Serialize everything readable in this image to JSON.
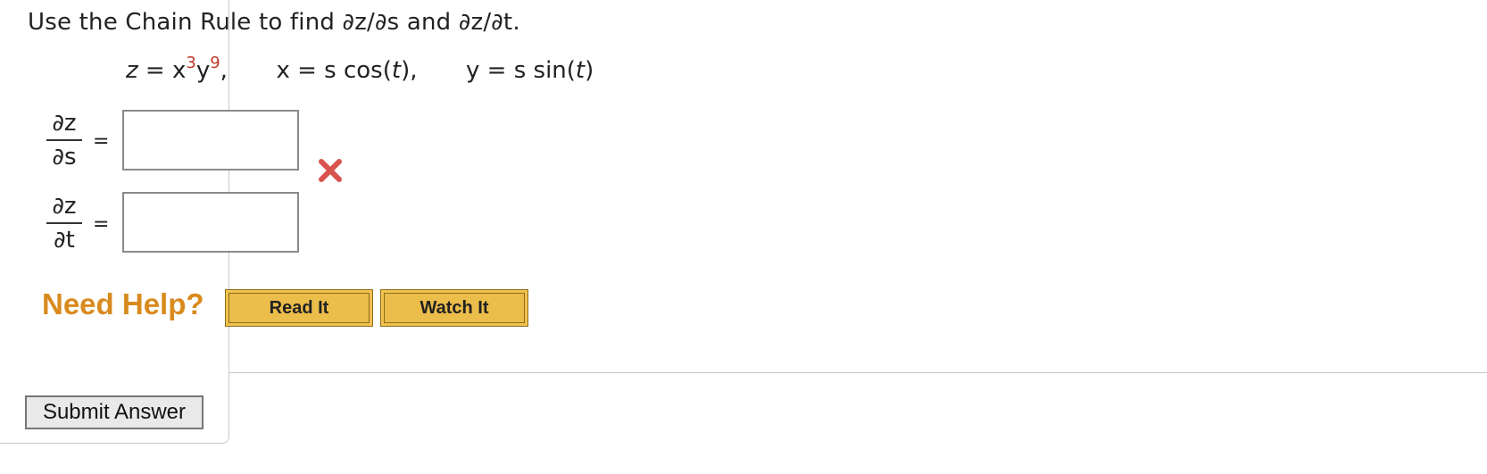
{
  "question": {
    "prompt": "Use the Chain Rule to find ∂z/∂s and ∂z/∂t.",
    "formula": {
      "z_lhs": "z",
      "z_eq": " = x",
      "z_exp1": "3",
      "z_mid": "y",
      "z_exp2": "9",
      "z_comma": ",",
      "x_part": "x = s cos(",
      "x_t": "t",
      "x_close": "),",
      "y_part": "y = s sin(",
      "y_t": "t",
      "y_close": ")"
    }
  },
  "answers": [
    {
      "num": "∂z",
      "den": "∂s",
      "eq": "=",
      "value": "",
      "status": "incorrect"
    },
    {
      "num": "∂z",
      "den": "∂t",
      "eq": "=",
      "value": "",
      "status": ""
    }
  ],
  "help": {
    "label": "Need Help?",
    "read_it": "Read It",
    "watch_it": "Watch It"
  },
  "submit_label": "Submit Answer",
  "colors": {
    "accent_orange": "#d98a1e",
    "button_gold": "#ebbd4a",
    "error_red": "#d9534f",
    "superscript_red": "#c0392b"
  }
}
